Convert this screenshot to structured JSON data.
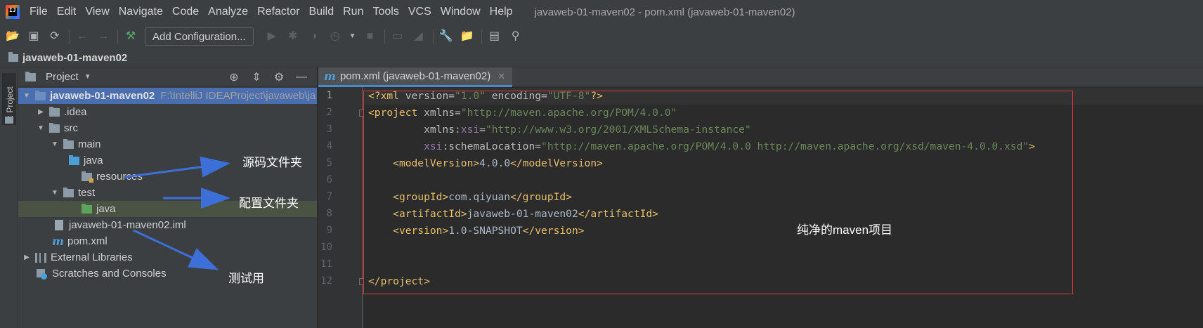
{
  "menubar": {
    "items": [
      "File",
      "Edit",
      "View",
      "Navigate",
      "Code",
      "Analyze",
      "Refactor",
      "Build",
      "Run",
      "Tools",
      "VCS",
      "Window",
      "Help"
    ],
    "window_title": "javaweb-01-maven02 - pom.xml (javaweb-01-maven02)"
  },
  "toolbar": {
    "add_configuration_label": "Add Configuration..."
  },
  "navbar": {
    "project_name": "javaweb-01-maven02"
  },
  "side_strip": {
    "tab_label": "1: Project"
  },
  "project_panel": {
    "title": "Project",
    "tree": {
      "root_name": "javaweb-01-maven02",
      "root_path": "F:\\IntelliJ IDEAProject\\javaweb\\ja",
      "idea": ".idea",
      "src": "src",
      "main": "main",
      "main_java": "java",
      "resources": "resources",
      "test": "test",
      "test_java": "java",
      "iml": "javaweb-01-maven02.iml",
      "pom": "pom.xml",
      "external_libraries": "External Libraries",
      "scratches": "Scratches and Consoles"
    }
  },
  "annotations": {
    "source_folder": "源码文件夹",
    "config_folder": "配置文件夹",
    "test_use": "测试用",
    "pure_maven": "纯净的maven项目",
    "arrow_color": "#3d6fd9",
    "box_color": "#e0383e"
  },
  "editor": {
    "tab_label": "pom.xml (javaweb-01-maven02)",
    "tab_icon": "m",
    "line_numbers": [
      "1",
      "2",
      "3",
      "4",
      "5",
      "6",
      "7",
      "8",
      "9",
      "10",
      "11",
      "12"
    ],
    "code": {
      "l1_decl": "<?xml",
      "l1_version_attr": " version=",
      "l1_version_val": "\"1.0\"",
      "l1_encoding_attr": " encoding=",
      "l1_encoding_val": "\"UTF-8\"",
      "l1_end": "?>",
      "l2_open": "<project",
      "l2_attr": " xmlns=",
      "l2_val": "\"http://maven.apache.org/POM/4.0.0\"",
      "l3_attr": "xmlns:",
      "l3_ns": "xsi",
      "l3_eq": "=",
      "l3_val": "\"http://www.w3.org/2001/XMLSchema-instance\"",
      "l4_ns": "xsi",
      "l4_attr": ":schemaLocation=",
      "l4_val": "\"http://maven.apache.org/POM/4.0.0 http://maven.apache.org/xsd/maven-4.0.0.xsd\"",
      "l4_end": ">",
      "model_open": "<modelVersion>",
      "model_val": "4.0.0",
      "model_close": "</modelVersion>",
      "group_open": "<groupId>",
      "group_val": "com.qiyuan",
      "group_close": "</groupId>",
      "artifact_open": "<artifactId>",
      "artifact_val": "javaweb-01-maven02",
      "artifact_close": "</artifactId>",
      "version_open": "<version>",
      "version_val": "1.0-SNAPSHOT",
      "version_close": "</version>",
      "project_close": "</project>"
    }
  }
}
